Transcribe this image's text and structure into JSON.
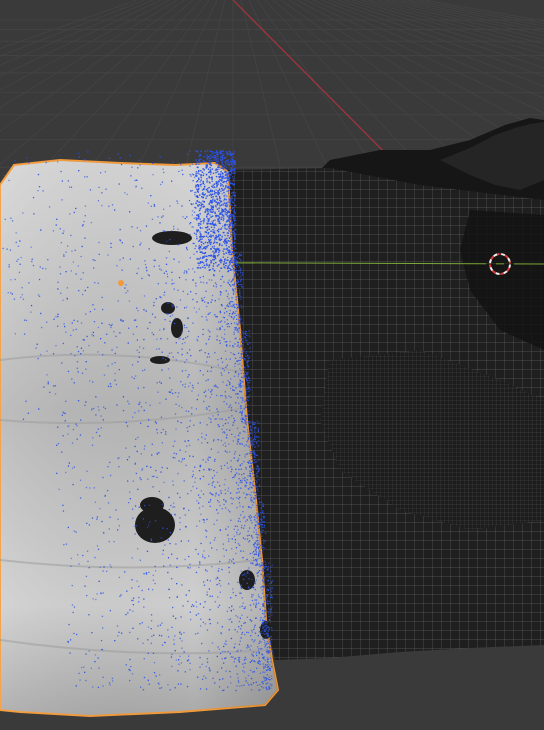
{
  "viewport": {
    "mode": "3D Viewport",
    "colors": {
      "background": "#3a3a3a",
      "floor_grid": "#444444",
      "x_axis": "#a8333d",
      "y_axis": "#7da83a",
      "selection_outline": "#f29a3b",
      "particles": "#2a52e8",
      "mesh_light": "#c9c9c9",
      "wireframe": "#6f6f6f",
      "terrain_dark": "#161616",
      "cursor_red": "#e23a3a",
      "cursor_white": "#f0f0f0"
    }
  },
  "scene": {
    "selected_object": "fluid-surface-mesh",
    "other_objects": [
      "terrain-wireframe",
      "mountain-backdrop"
    ],
    "icons": [
      "3d-cursor-icon",
      "object-origin-icon"
    ]
  }
}
